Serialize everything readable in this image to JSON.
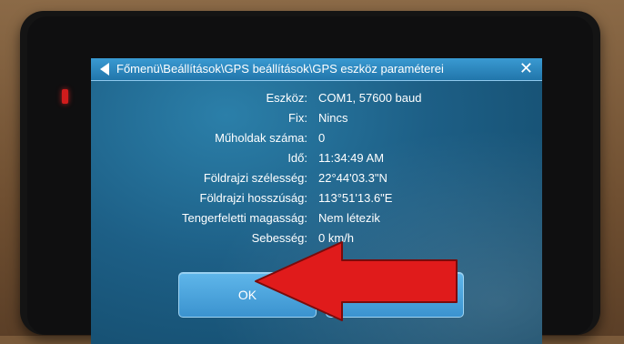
{
  "titlebar": {
    "title": "Főmenü\\Beállítások\\GPS beállítások\\GPS eszköz paraméterei",
    "back_icon": "back-arrow-icon",
    "close_icon": "close-icon",
    "close_glyph": "✕"
  },
  "fields": [
    {
      "label": "Eszköz:",
      "value": "COM1, 57600 baud"
    },
    {
      "label": "Fix:",
      "value": "Nincs"
    },
    {
      "label": "Műholdak száma:",
      "value": "0"
    },
    {
      "label": "Idő:",
      "value": "11:34:49 AM"
    },
    {
      "label": "Földrajzi szélesség:",
      "value": "22°44'03.3\"N"
    },
    {
      "label": "Földrajzi hosszúság:",
      "value": "113°51'13.6\"E"
    },
    {
      "label": "Tengerfeletti magasság:",
      "value": "Nem létezik"
    },
    {
      "label": "Sebesség:",
      "value": "0 km/h"
    }
  ],
  "buttons": {
    "ok_label": "OK",
    "second_label": ""
  },
  "annotation": {
    "arrow_color": "#e01b1b",
    "arrow_outline": "#7a0b0b"
  },
  "colors": {
    "titlebar": "#2176ab",
    "screen": "#1d5f86",
    "button": "#4aa4dd",
    "led": "#d01c1c"
  }
}
